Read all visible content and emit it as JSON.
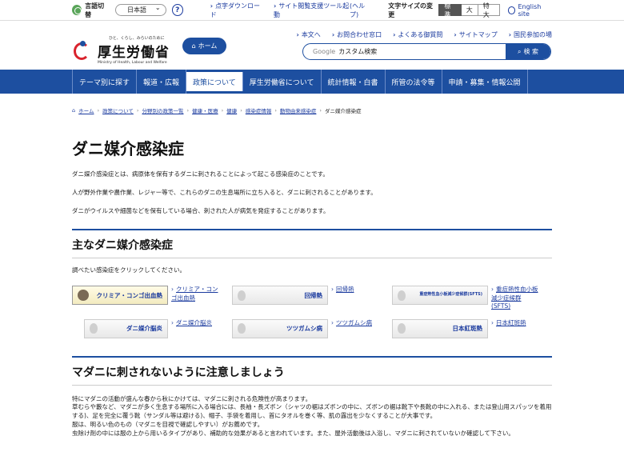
{
  "topbar": {
    "language_label": "言語切替",
    "language_selected": "日本語",
    "help": "?",
    "links": [
      "点字ダウンロード",
      "サイト閲覧支援ツール起動",
      "(ヘルプ)"
    ],
    "font_size_label": "文字サイズの変更",
    "font_sizes": [
      "標準",
      "大",
      "特大"
    ],
    "english": "English site"
  },
  "header": {
    "logo_tagline": "ひと、くらし、みらいのために",
    "logo_name": "厚生労働省",
    "logo_en": "Ministry of Health, Labour and Welfare",
    "home_button": "ホーム",
    "links": [
      "本文へ",
      "お問合わせ窓口",
      "よくある御質問",
      "サイトマップ",
      "国民参加の場"
    ],
    "search_brand": "Google",
    "search_value": "カスタム検索",
    "search_button": "検 索"
  },
  "gnav": [
    "テーマ別に探す",
    "報道・広報",
    "政策について",
    "厚生労働省について",
    "統計情報・白書",
    "所管の法令等",
    "申請・募集・情報公開"
  ],
  "gnav_active_index": 2,
  "breadcrumb": [
    "ホーム",
    "政策について",
    "分野別の政策一覧",
    "健康・医療",
    "健康",
    "感染症情報",
    "動物由来感染症"
  ],
  "breadcrumb_current": "ダニ媒介感染症",
  "page_title": "ダニ媒介感染症",
  "paragraphs": [
    "ダニ媒介感染症とは、病原体を保有するダニに刺されることによって起こる感染症のことです。",
    "人が野外作業や農作業、レジャー等で、これらのダニの生息場所に立ち入ると、ダニに刺されることがあります。",
    "ダニがウイルスや細菌などを保有している場合、刺された人が病気を発症することがあります。"
  ],
  "section1": {
    "heading": "主なダニ媒介感染症",
    "intro": "調べたい感染症をクリックしてください。",
    "diseases": [
      {
        "thumb": "クリミア・コンゴ出血熱",
        "link": "クリミア・コンゴ出血熱"
      },
      {
        "thumb": "回帰熱",
        "link": "回帰熱"
      },
      {
        "thumb": "重症熱性血小板減少症候群(SFTS)",
        "link": "重症熱性血小板減少症候群 (SFTS)"
      },
      {
        "thumb": "ダニ媒介脳炎",
        "link": "ダニ媒介脳炎"
      },
      {
        "thumb": "ツツガムシ病",
        "link": "ツツガムシ病"
      },
      {
        "thumb": "日本紅斑熱",
        "link": "日本紅斑熱"
      }
    ]
  },
  "section2": {
    "heading": "マダニに刺されないように注意しましょう",
    "lines": [
      "特にマダニの活動が盛んな春から秋にかけては、マダニに刺される危険性が高まります。",
      "草むらや藪など、マダニが多く生息する場所に入る場合には、長袖・長ズボン（シャツの裾はズボンの中に、ズボンの裾は靴下や長靴の中に入れる、または登山用スパッツを着用する)、足を完全に覆う靴（サンダル等は避ける)、帽子、手袋を着用し、首にタオルを巻く等、肌の露出を少なくすることが大事です。",
      "服は、明るい色のもの（マダニを目視で確認しやすい）がお薦めです。",
      "虫除け剤の中には服の上から用いるタイプがあり、補助的な効果があると言われています。また、屋外活動後は入浴し、マダニに刺されていないか確認して下さい。"
    ]
  },
  "colors": {
    "brand": "#1d4fa0",
    "logo_red": "#d9232d"
  }
}
